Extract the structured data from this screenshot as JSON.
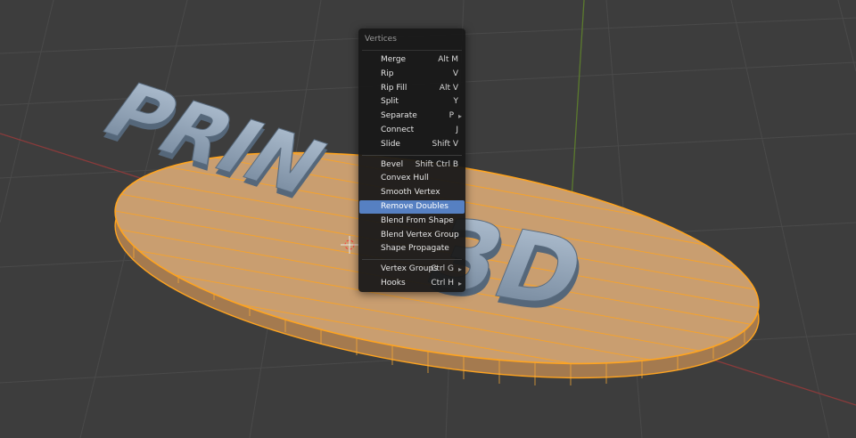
{
  "menu": {
    "title": "Vertices",
    "groups": [
      [
        {
          "label": "Merge",
          "shortcut": "Alt M",
          "submenu": false
        },
        {
          "label": "Rip",
          "shortcut": "V",
          "submenu": false
        },
        {
          "label": "Rip Fill",
          "shortcut": "Alt V",
          "submenu": false
        },
        {
          "label": "Split",
          "shortcut": "Y",
          "submenu": false
        },
        {
          "label": "Separate",
          "shortcut": "P",
          "submenu": true
        },
        {
          "label": "Connect",
          "shortcut": "J",
          "submenu": false
        },
        {
          "label": "Slide",
          "shortcut": "Shift V",
          "submenu": false
        }
      ],
      [
        {
          "label": "Bevel",
          "shortcut": "Shift Ctrl B",
          "submenu": false
        },
        {
          "label": "Convex Hull",
          "shortcut": "",
          "submenu": false
        },
        {
          "label": "Smooth Vertex",
          "shortcut": "",
          "submenu": false
        },
        {
          "label": "Remove Doubles",
          "shortcut": "",
          "submenu": false,
          "active": true
        },
        {
          "label": "Blend From Shape",
          "shortcut": "",
          "submenu": false
        },
        {
          "label": "Blend Vertex Group",
          "shortcut": "",
          "submenu": false
        },
        {
          "label": "Shape Propagate",
          "shortcut": "",
          "submenu": false
        }
      ],
      [
        {
          "label": "Vertex Groups",
          "shortcut": "Ctrl G",
          "submenu": true
        },
        {
          "label": "Hooks",
          "shortcut": "Ctrl H",
          "submenu": true
        }
      ]
    ]
  },
  "scene": {
    "model_text_left": "PRIN",
    "model_text_right": "3D",
    "colors": {
      "background": "#3d3d3d",
      "grid": "#4a4a4a",
      "mesh_face": "#c79a6b",
      "mesh_edge": "#ffa41f",
      "letters": "#8fa2b8",
      "x_axis": "#8a3b3b",
      "y_axis": "#5b7a2e",
      "menu_highlight": "#5680c2"
    },
    "icons": [
      "cursor-icon",
      "submenu-arrow-icon"
    ]
  }
}
